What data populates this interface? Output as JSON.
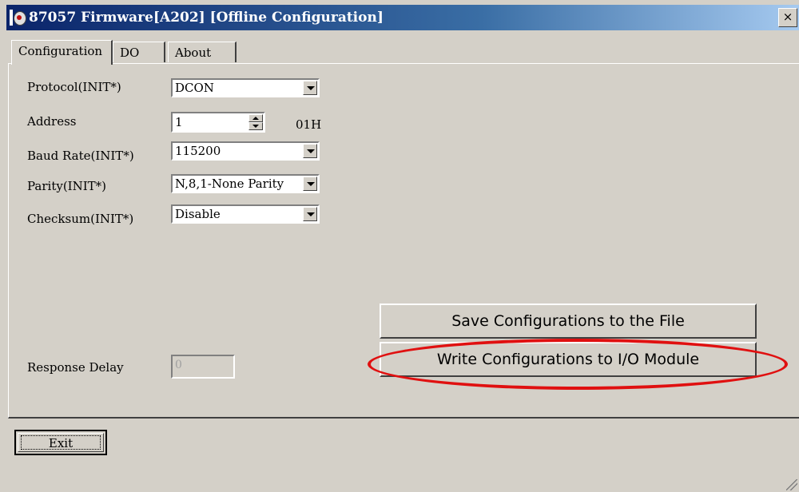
{
  "window": {
    "title": "87057 Firmware[A202] [Offline Configuration]",
    "close_label": "×"
  },
  "tabs": [
    {
      "label": "Configuration"
    },
    {
      "label": "DO"
    },
    {
      "label": "About"
    }
  ],
  "form": {
    "protocol": {
      "label": "Protocol(INIT*)",
      "value": "DCON"
    },
    "address": {
      "label": "Address",
      "value": "1",
      "hex": "01H"
    },
    "baud_rate": {
      "label": "Baud Rate(INIT*)",
      "value": "115200"
    },
    "parity": {
      "label": "Parity(INIT*)",
      "value": "N,8,1-None Parity"
    },
    "checksum": {
      "label": "Checksum(INIT*)",
      "value": "Disable"
    },
    "response_delay": {
      "label": "Response Delay",
      "value": "0"
    }
  },
  "buttons": {
    "save": "Save Configurations to the File",
    "write": "Write Configurations to I/O Module",
    "exit": "Exit"
  },
  "highlight_color": "#e01010"
}
